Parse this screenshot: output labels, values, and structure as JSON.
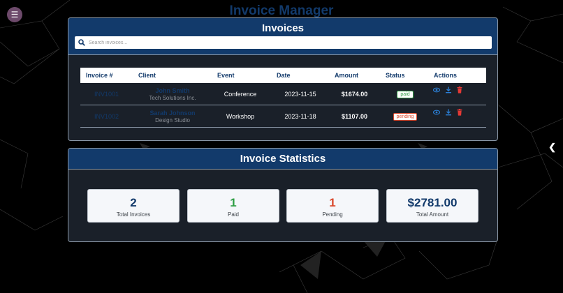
{
  "app": {
    "title": "Invoice Manager"
  },
  "icons": {
    "menu": "hamburger-icon",
    "side": "chevron-left-icon",
    "search": "search-icon",
    "view": "eye-icon",
    "download": "download-icon",
    "delete": "trash-icon"
  },
  "colors": {
    "navy": "#123a6b",
    "paid": "#2e9e44",
    "pending": "#d9472b",
    "delete": "#e53935"
  },
  "invoices_card": {
    "title": "Invoices",
    "search_placeholder": "Search invoices...",
    "columns": [
      "Invoice #",
      "Client",
      "Event",
      "Date",
      "Amount",
      "Status",
      "Actions"
    ],
    "rows": [
      {
        "number": "INV1001",
        "client_name": "John Smith",
        "client_company": "Tech Solutions Inc.",
        "event": "Conference",
        "date": "2023-11-15",
        "amount": "$1674.00",
        "status": "paid"
      },
      {
        "number": "INV1002",
        "client_name": "Sarah Johnson",
        "client_company": "Design Studio",
        "event": "Workshop",
        "date": "2023-11-18",
        "amount": "$1107.00",
        "status": "pending"
      }
    ]
  },
  "stats_card": {
    "title": "Invoice Statistics",
    "stats": [
      {
        "value": "2",
        "label": "Total Invoices",
        "color": "#123a6b"
      },
      {
        "value": "1",
        "label": "Paid",
        "color": "#2e9e44"
      },
      {
        "value": "1",
        "label": "Pending",
        "color": "#d9472b"
      },
      {
        "value": "$2781.00",
        "label": "Total Amount",
        "color": "#123a6b"
      }
    ]
  }
}
